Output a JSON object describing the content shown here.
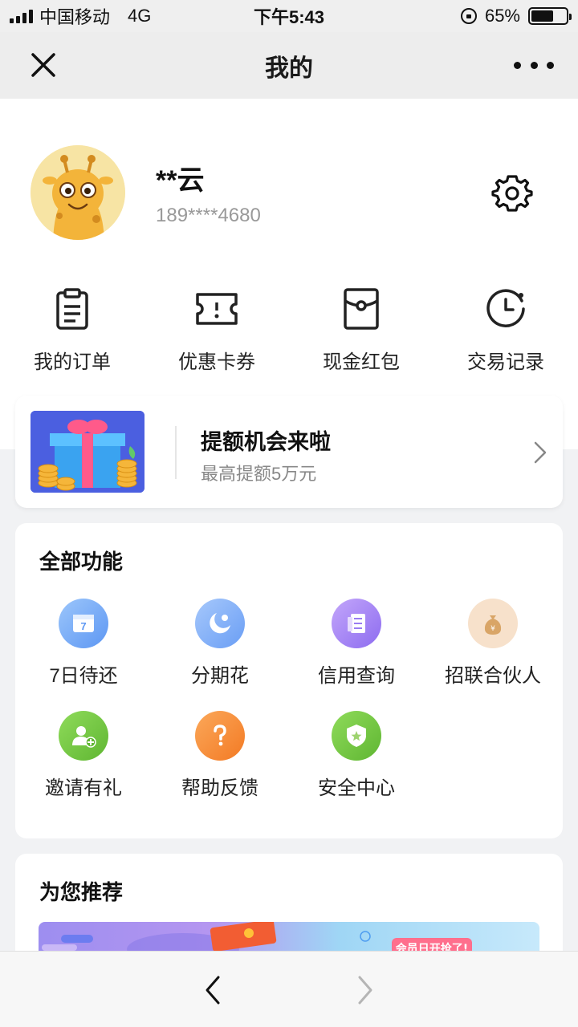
{
  "status_bar": {
    "carrier": "中国移动",
    "network": "4G",
    "time": "下午5:43",
    "battery_percent": "65%",
    "battery_level": 0.65
  },
  "nav": {
    "title": "我的",
    "close_icon": "close-icon",
    "more_icon": "more-icon"
  },
  "profile": {
    "name": "**云",
    "phone": "189****4680",
    "avatar_icon": "giraffe-avatar",
    "settings_icon": "gear-icon"
  },
  "quick_actions": [
    {
      "label": "我的订单",
      "icon": "clipboard-icon"
    },
    {
      "label": "优惠卡券",
      "icon": "ticket-icon"
    },
    {
      "label": "现金红包",
      "icon": "red-envelope-icon"
    },
    {
      "label": "交易记录",
      "icon": "clock-icon"
    }
  ],
  "promo": {
    "title": "提额机会来啦",
    "subtitle": "最高提额5万元",
    "image_icon": "gift-coins-image"
  },
  "functions": {
    "title": "全部功能",
    "items": [
      {
        "label": "7日待还",
        "icon": "calendar-icon",
        "color": "#7aaef6"
      },
      {
        "label": "分期花",
        "icon": "moon-icon",
        "color": "#7fb0f7"
      },
      {
        "label": "信用查询",
        "icon": "document-icon",
        "color": "#a988f2"
      },
      {
        "label": "招联合伙人",
        "icon": "money-bag-icon",
        "color": "#f6dcc3"
      },
      {
        "label": "邀请有礼",
        "icon": "add-user-icon",
        "color": "#7fcc4a"
      },
      {
        "label": "帮助反馈",
        "icon": "question-icon",
        "color": "#f88e3b"
      },
      {
        "label": "安全中心",
        "icon": "shield-icon",
        "color": "#7fcc4a"
      }
    ]
  },
  "recommend": {
    "title": "为您推荐",
    "banner_text": "会员日开抢了!"
  },
  "toolbar": {
    "back_icon": "chevron-left-icon",
    "forward_icon": "chevron-right-icon"
  }
}
